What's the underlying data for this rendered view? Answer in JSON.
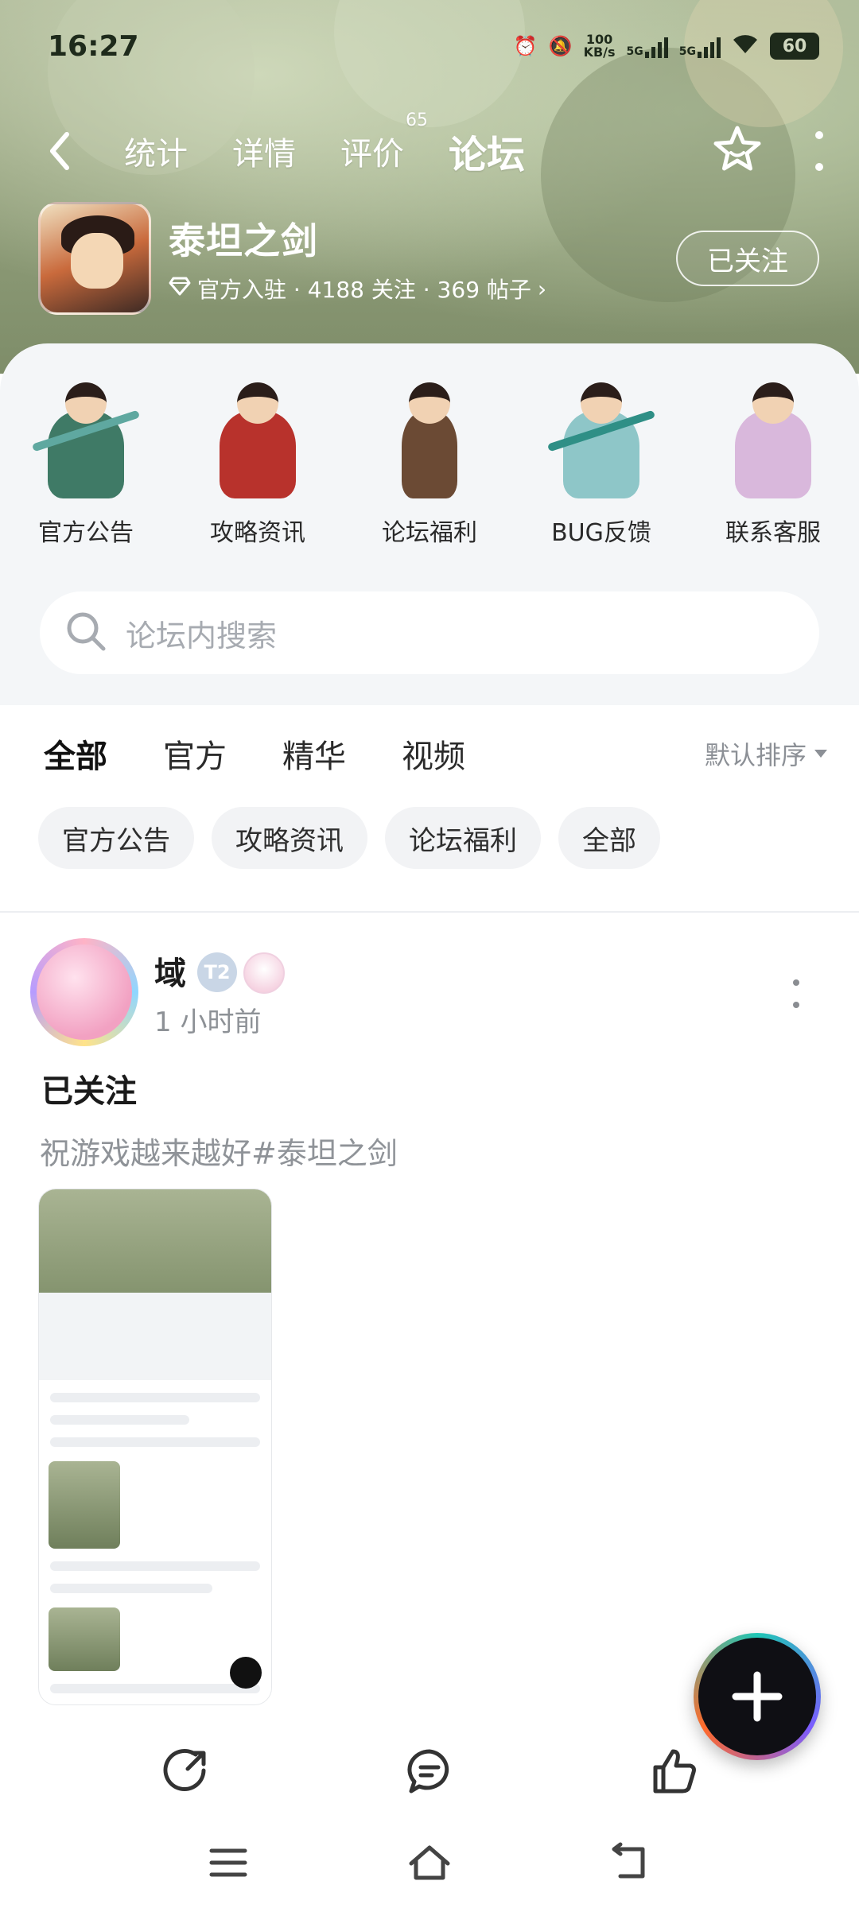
{
  "status": {
    "time": "16:27",
    "net_speed": "100\nKB/s",
    "sig1": "5G",
    "sig2": "5G",
    "battery": "60"
  },
  "topnav": {
    "tabs": [
      {
        "label": "统计"
      },
      {
        "label": "详情"
      },
      {
        "label": "评价",
        "badge": "65"
      },
      {
        "label": "论坛",
        "active": true
      }
    ]
  },
  "game": {
    "title": "泰坦之剑",
    "meta": "官方入驻 · 4188 关注 · 369 帖子",
    "follow_label": "已关注"
  },
  "shortcuts": [
    {
      "label": "官方公告"
    },
    {
      "label": "攻略资讯"
    },
    {
      "label": "论坛福利"
    },
    {
      "label": "BUG反馈"
    },
    {
      "label": "联系客服"
    }
  ],
  "search": {
    "placeholder": "论坛内搜索"
  },
  "filters": {
    "tabs": [
      "全部",
      "官方",
      "精华",
      "视频"
    ],
    "sort_label": "默认排序",
    "chips": [
      "官方公告",
      "攻略资讯",
      "论坛福利",
      "全部"
    ]
  },
  "post": {
    "author": "域",
    "level": "T2",
    "time": "1 小时前",
    "title": "已关注",
    "body": "祝游戏越来越好#泰坦之剑"
  },
  "colors": {
    "accent": "#20c7b6",
    "hero": "#93a07c"
  }
}
